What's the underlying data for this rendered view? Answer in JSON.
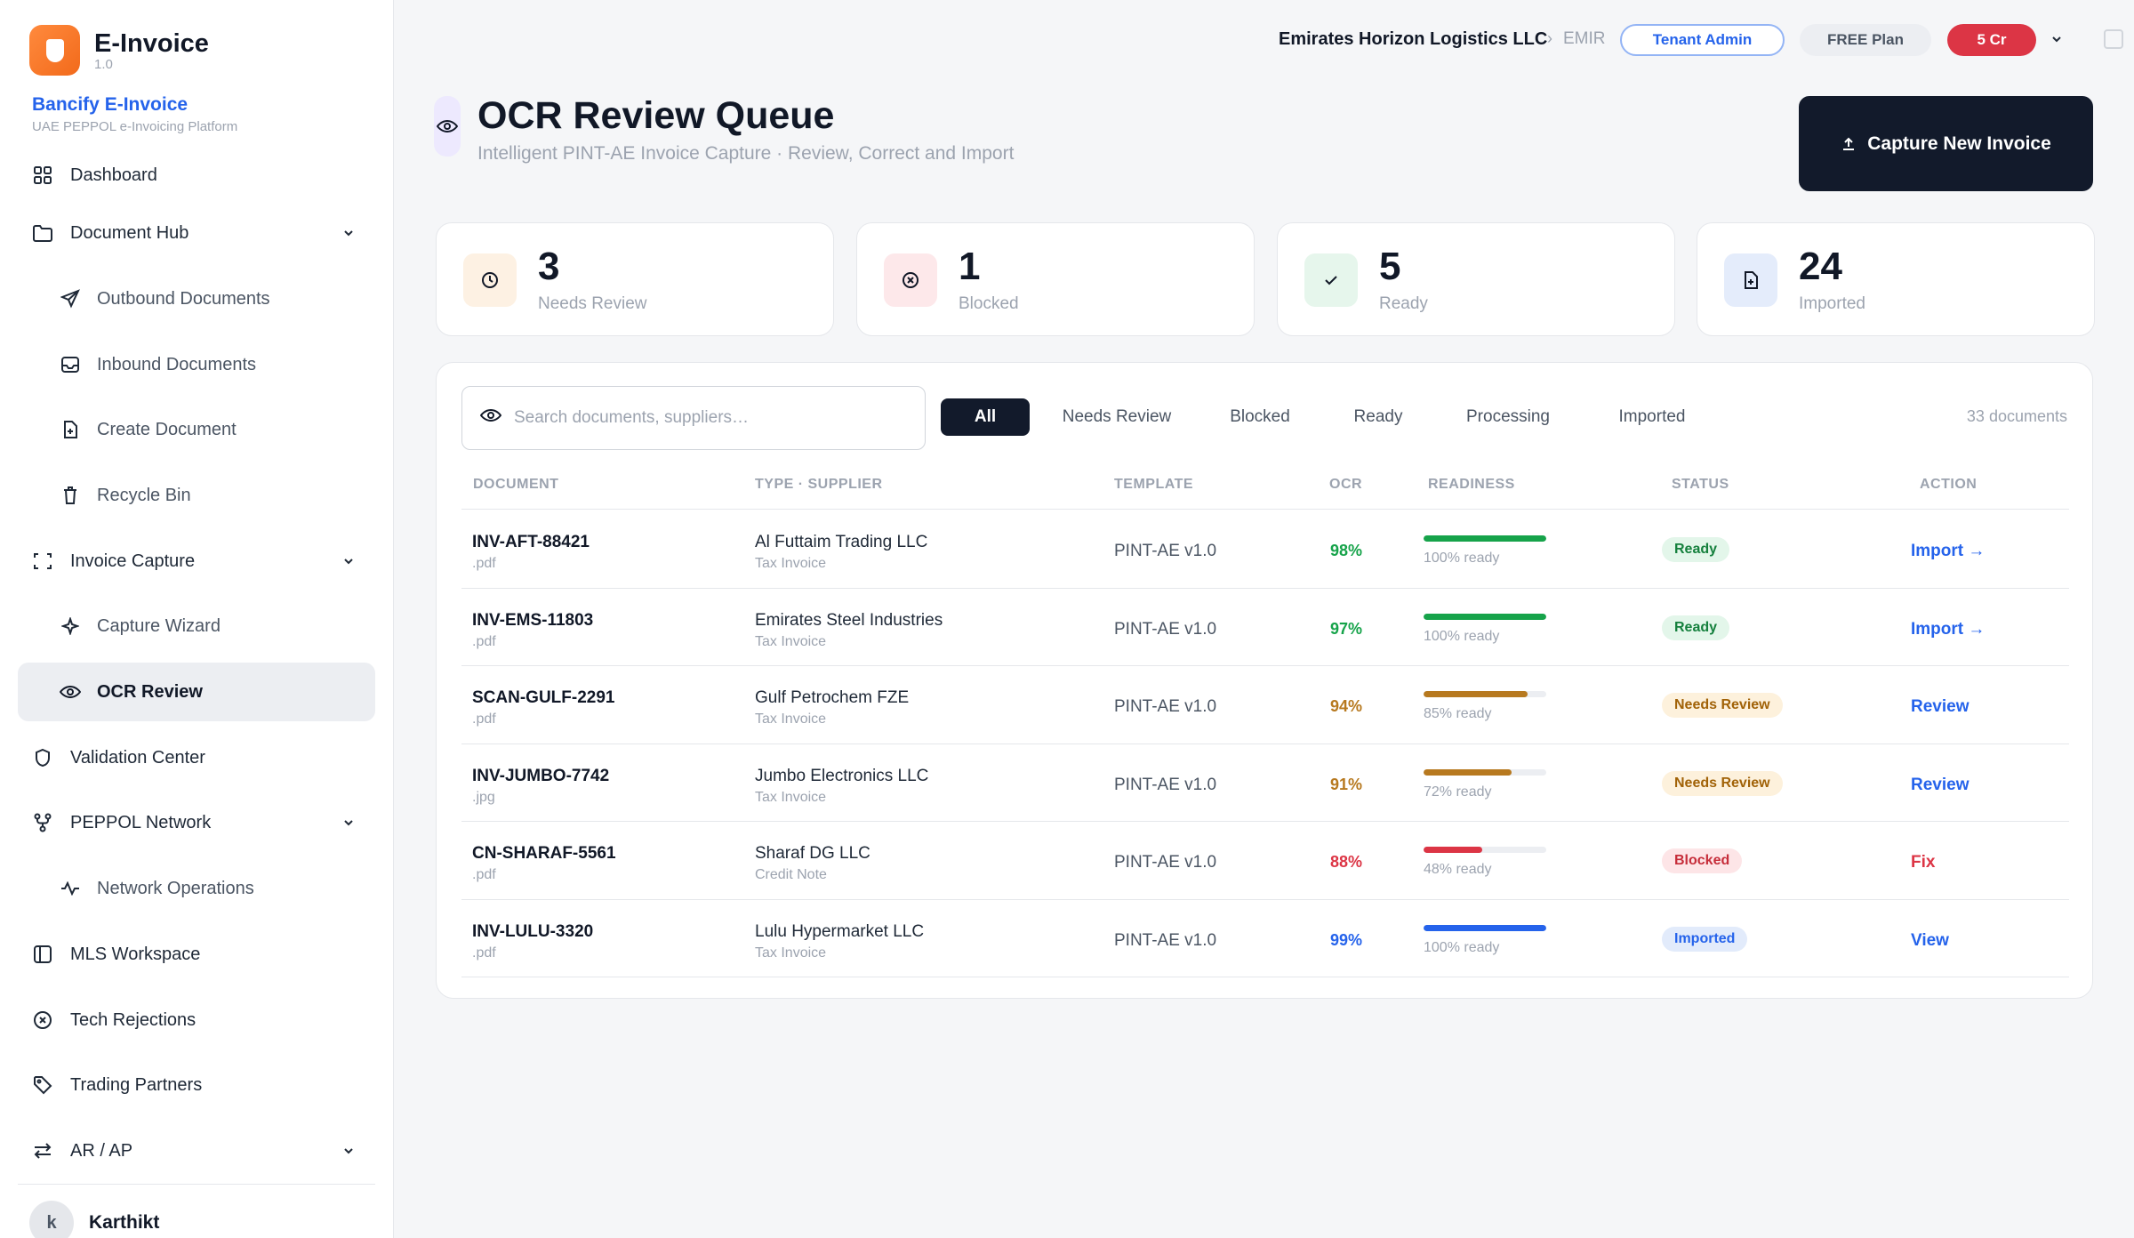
{
  "app": {
    "name": "E-Invoice",
    "version": "1.0"
  },
  "org": {
    "name": "Bancify E-Invoice",
    "subtitle": "UAE PEPPOL e-Invoicing Platform"
  },
  "nav": {
    "dashboard": "Dashboard",
    "document_hub": "Document Hub",
    "outbound": "Outbound Documents",
    "inbound": "Inbound Documents",
    "create": "Create Document",
    "recycle": "Recycle Bin",
    "invoice_capture": "Invoice Capture",
    "capture_wizard": "Capture Wizard",
    "ocr_review": "OCR Review",
    "validation": "Validation Center",
    "peppol": "PEPPOL Network",
    "network_ops": "Network Operations",
    "mls": "MLS Workspace",
    "tech_rejections": "Tech Rejections",
    "trading_partners": "Trading Partners",
    "ar_ap": "AR / AP"
  },
  "user": {
    "initial": "k",
    "name": "Karthikt"
  },
  "topbar": {
    "tenant": "Emirates Horizon Logistics LLC",
    "separator": "›",
    "tenant_code": "EMIR",
    "role": "Tenant Admin",
    "plan": "FREE Plan",
    "credits": "5 Cr"
  },
  "header": {
    "title": "OCR Review Queue",
    "subtitle": "Intelligent PINT-AE Invoice Capture · Review, Correct and Import",
    "capture_button": "Capture New Invoice"
  },
  "stats": [
    {
      "value": "3",
      "label": "Needs Review"
    },
    {
      "value": "1",
      "label": "Blocked"
    },
    {
      "value": "5",
      "label": "Ready"
    },
    {
      "value": "24",
      "label": "Imported"
    }
  ],
  "search": {
    "placeholder": "Search documents, suppliers…",
    "value": ""
  },
  "filters": [
    "All",
    "Needs Review",
    "Blocked",
    "Ready",
    "Processing",
    "Imported"
  ],
  "doc_count": "33 documents",
  "columns": {
    "document": "DOCUMENT",
    "type_supplier": "TYPE · SUPPLIER",
    "template": "TEMPLATE",
    "ocr": "OCR",
    "readiness": "READINESS",
    "status": "STATUS",
    "action": "ACTION"
  },
  "rows": [
    {
      "doc": "INV-AFT-88421",
      "ext": ".pdf",
      "supplier": "Al Futtaim Trading LLC",
      "type": "Tax Invoice",
      "template": "PINT-AE v1.0",
      "ocr": "98%",
      "readiness": 1.0,
      "readiness_text": "100% ready",
      "status": "Ready",
      "action": "Import →"
    },
    {
      "doc": "INV-EMS-11803",
      "ext": ".pdf",
      "supplier": "Emirates Steel Industries",
      "type": "Tax Invoice",
      "template": "PINT-AE v1.0",
      "ocr": "97%",
      "readiness": 1.0,
      "readiness_text": "100% ready",
      "status": "Ready",
      "action": "Import →"
    },
    {
      "doc": "SCAN-GULF-2291",
      "ext": ".pdf",
      "supplier": "Gulf Petrochem FZE",
      "type": "Tax Invoice",
      "template": "PINT-AE v1.0",
      "ocr": "94%",
      "readiness": 0.85,
      "readiness_text": "85% ready",
      "status": "Needs Review",
      "action": "Review"
    },
    {
      "doc": "INV-JUMBO-7742",
      "ext": ".jpg",
      "supplier": "Jumbo Electronics LLC",
      "type": "Tax Invoice",
      "template": "PINT-AE v1.0",
      "ocr": "91%",
      "readiness": 0.72,
      "readiness_text": "72% ready",
      "status": "Needs Review",
      "action": "Review"
    },
    {
      "doc": "CN-SHARAF-5561",
      "ext": ".pdf",
      "supplier": "Sharaf DG LLC",
      "type": "Credit Note",
      "template": "PINT-AE v1.0",
      "ocr": "88%",
      "readiness": 0.48,
      "readiness_text": "48% ready",
      "status": "Blocked",
      "action": "Fix"
    },
    {
      "doc": "INV-LULU-3320",
      "ext": ".pdf",
      "supplier": "Lulu Hypermarket LLC",
      "type": "Tax Invoice",
      "template": "PINT-AE v1.0",
      "ocr": "99%",
      "readiness": 1.0,
      "readiness_text": "100% ready",
      "status": "Imported",
      "action": "View"
    }
  ],
  "colors": {
    "green": "#16a34a",
    "amber": "#b7791f",
    "red": "#dc3545",
    "blue": "#2563eb",
    "brand_orange": "#f26a1b",
    "dark": "#121a2b"
  }
}
